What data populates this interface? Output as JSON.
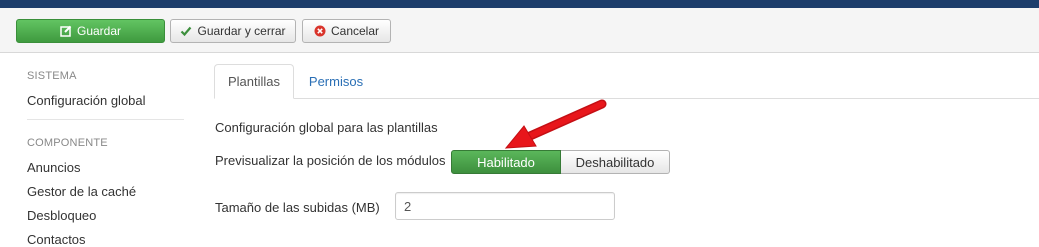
{
  "toolbar": {
    "save_label": "Guardar",
    "save_close_label": "Guardar y cerrar",
    "cancel_label": "Cancelar"
  },
  "sidebar": {
    "section_system": "SISTEMA",
    "global_config": "Configuración global",
    "section_component": "COMPONENTE",
    "items": [
      "Anuncios",
      "Gestor de la caché",
      "Desbloqueo",
      "Contactos"
    ]
  },
  "tabs": [
    {
      "label": "Plantillas",
      "active": true
    },
    {
      "label": "Permisos",
      "active": false
    }
  ],
  "form": {
    "title": "Configuración global para las plantillas",
    "preview_label": "Previsualizar la posición de los módulos",
    "toggle_on": "Habilitado",
    "toggle_off": "Deshabilitado",
    "toggle_selected": "Habilitado",
    "upload_label": "Tamaño de las subidas (MB)",
    "upload_value": "2"
  },
  "colors": {
    "topbar": "#1c3d6b",
    "save_green": "#4caf50",
    "link_blue": "#2a6fb5",
    "annotation_arrow": "#e8161b"
  }
}
